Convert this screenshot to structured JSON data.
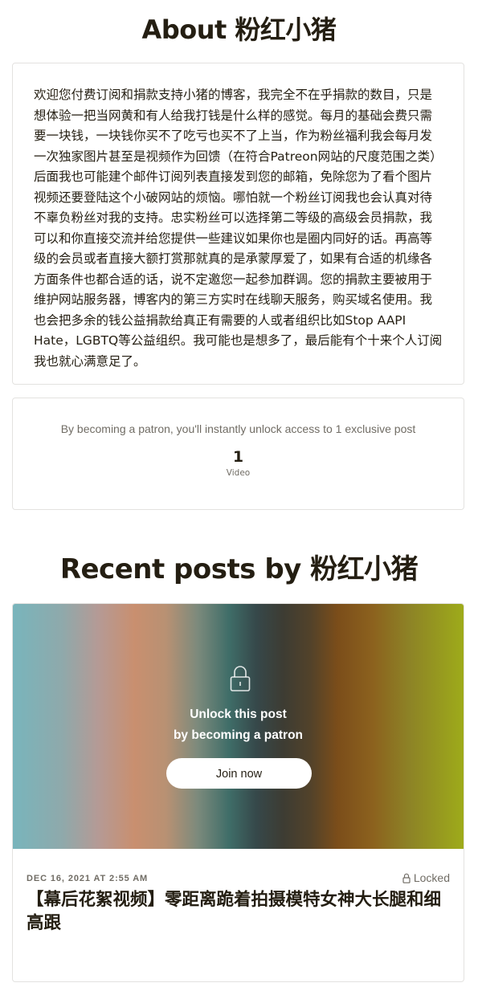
{
  "about": {
    "title": "About 粉红小猪",
    "body": "欢迎您付费订阅和捐款支持小猪的博客，我完全不在乎捐款的数目，只是想体验一把当网黄和有人给我打钱是什么样的感觉。每月的基础会费只需要一块钱，一块钱你买不了吃亏也买不了上当，作为粉丝福利我会每月发一次独家图片甚至是视频作为回馈（在符合Patreon网站的尺度范围之类）后面我也可能建个邮件订阅列表直接发到您的邮箱，免除您为了看个图片视频还要登陆这个小破网站的烦恼。哪怕就一个粉丝订阅我也会认真对待不辜负粉丝对我的支持。忠实粉丝可以选择第二等级的高级会员捐款，我可以和你直接交流并给您提供一些建议如果你也是圈内同好的话。再高等级的会员或者直接大额打赏那就真的是承蒙厚爱了，如果有合适的机缘各方面条件也都合适的话，说不定邀您一起参加群调。您的捐款主要被用于维护网站服务器，博客内的第三方实时在线聊天服务，购买域名使用。我也会把多余的钱公益捐款给真正有需要的人或者组织比如Stop AAPI Hate，LGBTQ等公益组织。我可能也是想多了，最后能有个十来个人订阅我也就心满意足了。"
  },
  "benefits": {
    "summary": "By becoming a patron, you'll instantly unlock access to 1 exclusive post",
    "count": "1",
    "label": "Video"
  },
  "recent": {
    "title": "Recent posts by 粉红小猪",
    "post": {
      "unlock_line1": "Unlock this post",
      "unlock_line2": "by becoming a patron",
      "join_label": "Join now",
      "date": "DEC 16, 2021 AT 2:55 AM",
      "status": "Locked",
      "status_icon": "lock-icon",
      "title": "【幕后花絮视频】零距离跪着拍摄模特女神大长腿和细高跟"
    }
  },
  "colors": {
    "text": "#241e12",
    "muted": "#706c64",
    "border": "#e3e2e0"
  }
}
